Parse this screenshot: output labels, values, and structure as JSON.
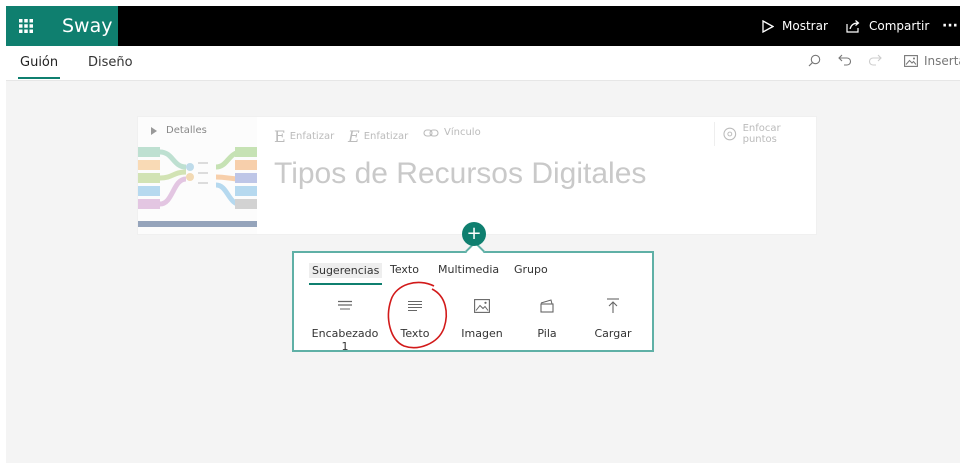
{
  "app": {
    "name": "Sway"
  },
  "topbar": {
    "present_label": "Mostrar",
    "share_label": "Compartir",
    "more_label": "···"
  },
  "subbar": {
    "tabs": [
      {
        "label": "Guión",
        "active": true
      },
      {
        "label": "Diseño",
        "active": false
      }
    ],
    "insert_label": "Insertar"
  },
  "card": {
    "details_label": "Detalles",
    "format": {
      "emphasize_label": "Enfatizar",
      "italic_label": "Enfatizar",
      "link_label": "Vínculo",
      "focus_label": "Enfocar puntos"
    },
    "heading": "Tipos de Recursos Digitales"
  },
  "popup": {
    "tabs": [
      {
        "label": "Sugerencias",
        "active": true
      },
      {
        "label": "Texto",
        "active": false
      },
      {
        "label": "Multimedia",
        "active": false
      },
      {
        "label": "Grupo",
        "active": false
      }
    ],
    "items": [
      {
        "label": "Encabezado 1",
        "icon": "heading-icon"
      },
      {
        "label": "Texto",
        "icon": "text-lines-icon"
      },
      {
        "label": "Imagen",
        "icon": "image-icon"
      },
      {
        "label": "Pila",
        "icon": "stack-icon"
      },
      {
        "label": "Cargar",
        "icon": "upload-icon"
      }
    ]
  },
  "colors": {
    "accent": "#0f7f6f",
    "topbar": "#000000",
    "popup_border": "#5fb0a6",
    "annotation": "#d21a1a"
  }
}
